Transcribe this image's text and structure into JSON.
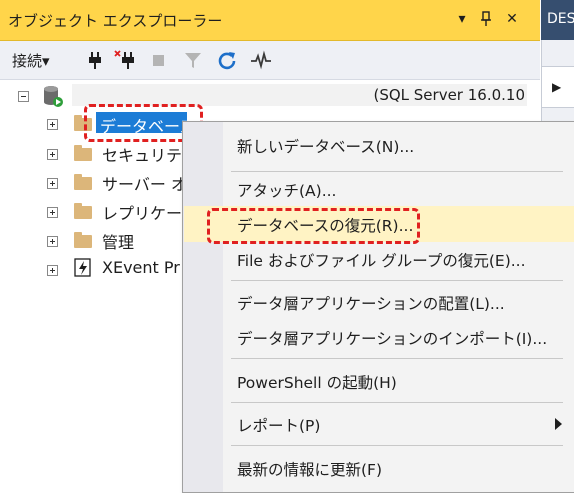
{
  "panel": {
    "title": "オブジェクト エクスプローラー",
    "pin_icon": "▾",
    "autohide_icon": "⊥",
    "close_icon": "✕",
    "right_tab_label": "DES"
  },
  "toolbar": {
    "connect_label": "接続▾",
    "icons": [
      "connect-plug-icon",
      "disconnect-plug-icon",
      "stop-icon",
      "filter-icon",
      "refresh-icon",
      "activity-monitor-icon"
    ]
  },
  "tree": {
    "server_text": "(SQL Server 16.0.10",
    "nodes": [
      {
        "label": "データベース"
      },
      {
        "label": "セキュリティ"
      },
      {
        "label": "サーバー オ"
      },
      {
        "label": "レプリケーシ"
      },
      {
        "label": "管理"
      },
      {
        "label": "XEvent Pr"
      }
    ]
  },
  "menu": {
    "items": [
      {
        "label": "新しいデータベース(N)..."
      },
      {
        "label": "アタッチ(A)..."
      },
      {
        "label": "データベースの復元(R)..."
      },
      {
        "label": "File およびファイル グループの復元(E)..."
      },
      {
        "label": "データ層アプリケーションの配置(L)..."
      },
      {
        "label": "データ層アプリケーションのインポート(I)..."
      },
      {
        "label": "PowerShell の起動(H)"
      },
      {
        "label": "レポート(P)"
      },
      {
        "label": "最新の情報に更新(F)"
      }
    ]
  },
  "colors": {
    "titlebar": "#ffd54a",
    "selection": "#1c7cd6",
    "highlight": "#e02020"
  }
}
